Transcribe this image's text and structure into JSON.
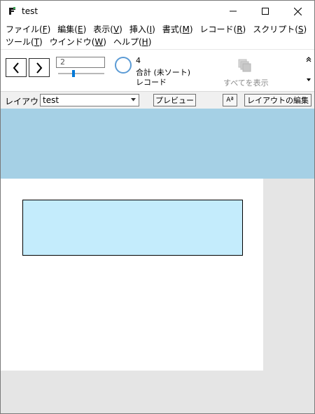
{
  "window": {
    "title": "test",
    "icons": {
      "app": "filemaker-icon",
      "minimize": "minimize-icon",
      "maximize": "maximize-icon",
      "close": "close-icon"
    }
  },
  "menu": {
    "row1": [
      {
        "label": "ファイル(",
        "key": "F",
        "end": ")"
      },
      {
        "label": "編集(",
        "key": "E",
        "end": ")"
      },
      {
        "label": "表示(",
        "key": "V",
        "end": ")"
      },
      {
        "label": "挿入(",
        "key": "I",
        "end": ")"
      },
      {
        "label": "書式(",
        "key": "M",
        "end": ")"
      },
      {
        "label": "レコード(",
        "key": "R",
        "end": ")"
      },
      {
        "label": "スクリプト(",
        "key": "S",
        "end": ")"
      }
    ],
    "row2": [
      {
        "label": "ツール(",
        "key": "T",
        "end": ")"
      },
      {
        "label": "ウインドウ(",
        "key": "W",
        "end": ")"
      },
      {
        "label": "ヘルプ(",
        "key": "H",
        "end": ")"
      }
    ]
  },
  "toolbar": {
    "record_number": "2",
    "slider_fraction": 0.32,
    "found_count": "4",
    "sort_status": "合計 (未ソート)",
    "records_label": "レコード",
    "show_all_label": "すべてを表示"
  },
  "layoutbar": {
    "label": "レイアウト:",
    "selected_layout": "test",
    "preview_button": "プレビュー",
    "format_button": "Aª",
    "edit_layout_button": "レイアウトの編集"
  },
  "colors": {
    "header_part": "#a5d0e5",
    "field_fill": "#c4ecfc",
    "pie_stroke": "#5b9bd5",
    "slider_thumb": "#0078d7"
  }
}
